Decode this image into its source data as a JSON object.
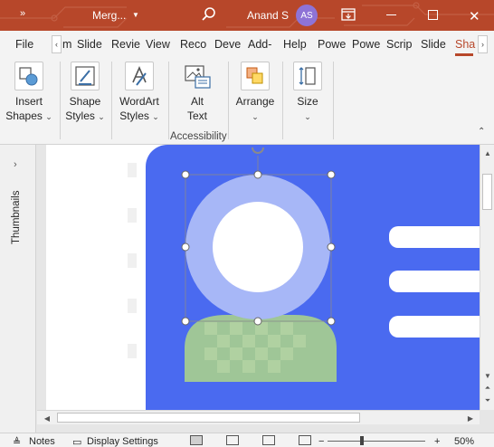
{
  "titlebar": {
    "overflow_label": "»",
    "title": "Merg...",
    "user_name": "Anand S",
    "user_initials": "AS",
    "close_glyph": "✕"
  },
  "tabs": [
    {
      "label": "File",
      "active": false
    },
    {
      "label": "m",
      "active": false
    },
    {
      "label": "Slide",
      "active": false
    },
    {
      "label": "Revie",
      "active": false
    },
    {
      "label": "View",
      "active": false
    },
    {
      "label": "Reco",
      "active": false
    },
    {
      "label": "Deve",
      "active": false
    },
    {
      "label": "Add-",
      "active": false
    },
    {
      "label": "Help",
      "active": false
    },
    {
      "label": "Powe",
      "active": false
    },
    {
      "label": "Powe",
      "active": false
    },
    {
      "label": "Scrip",
      "active": false
    },
    {
      "label": "Slide",
      "active": false
    },
    {
      "label": "Sha",
      "active": true
    }
  ],
  "ribbon": {
    "insert_shapes": {
      "line1": "Insert",
      "line2": "Shapes"
    },
    "shape_styles": {
      "line1": "Shape",
      "line2": "Styles"
    },
    "wordart_styles": {
      "line1": "WordArt",
      "line2": "Styles"
    },
    "alt_text": {
      "line1": "Alt",
      "line2": "Text"
    },
    "arrange": {
      "line1": "Arrange"
    },
    "size": {
      "line1": "Size"
    },
    "accessibility_caption": "Accessibility"
  },
  "thumbnails_pane": {
    "label": "Thumbnails"
  },
  "statusbar": {
    "notes": "Notes",
    "display_settings": "Display Settings",
    "zoom_minus": "−",
    "zoom_plus": "+",
    "zoom_percent": "50%"
  },
  "colors": {
    "accent": "#b7472a",
    "slide_blue": "#4a6af0",
    "ring": "#a7b7f7",
    "shape_green": "#a8d08d",
    "avatar": "#8e73d6"
  }
}
